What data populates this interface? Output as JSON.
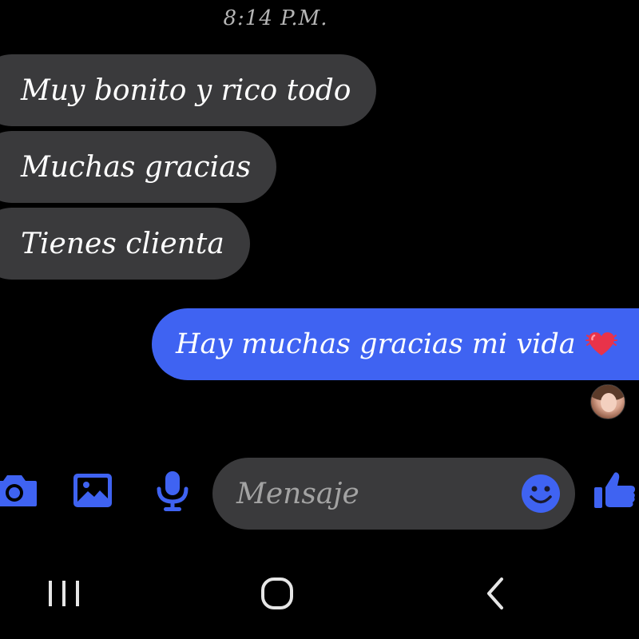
{
  "status": {
    "time": "8:14 P.M."
  },
  "messages": [
    {
      "direction": "incoming",
      "text": "Muy bonito y rico todo"
    },
    {
      "direction": "incoming",
      "text": "Muchas gracias"
    },
    {
      "direction": "incoming",
      "text": "Tienes clienta"
    },
    {
      "direction": "outgoing",
      "text": "Hay muchas gracias mi vida",
      "emoji": "beating-heart-icon"
    }
  ],
  "composer": {
    "placeholder": "Mensaje",
    "icons": [
      "camera-icon",
      "gallery-icon",
      "microphone-icon",
      "emoji-icon",
      "thumbs-up-icon"
    ]
  },
  "nav": {
    "buttons": [
      "recents-icon",
      "home-icon",
      "back-icon"
    ]
  },
  "colors": {
    "background": "#000000",
    "incoming_bubble": "#3a3a3c",
    "outgoing_bubble": "#3f63f2",
    "accent": "#3f63f2",
    "text": "#ffffff",
    "placeholder": "#a3a3a3"
  }
}
